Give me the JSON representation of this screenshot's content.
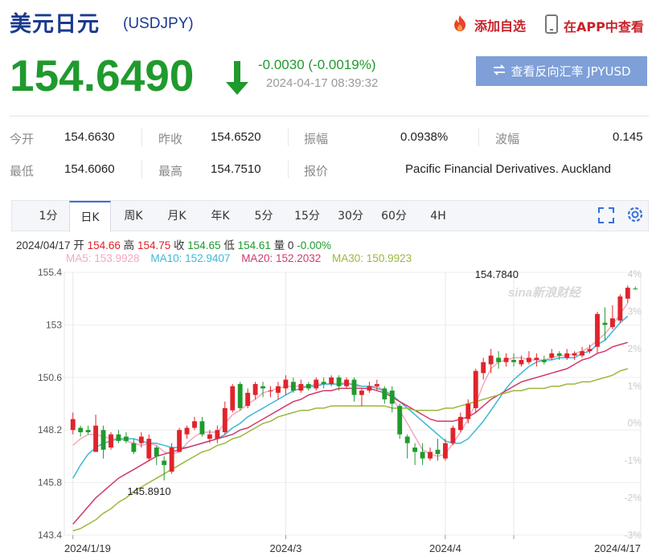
{
  "header": {
    "title": "美元日元",
    "code": "(USDJPY)",
    "fav_label": "添加自选",
    "app_label": "在APP中查看",
    "price": "154.6490",
    "change": "-0.0030 (-0.0019%)",
    "timestamp": "2024-04-17 08:39:32",
    "reverse_label": "查看反向汇率 JPYUSD"
  },
  "quote": {
    "open_label": "今开",
    "open_value": "154.6630",
    "prev_close_label": "昨收",
    "prev_close_value": "154.6520",
    "amplitude_label": "振幅",
    "amplitude_value": "0.0938%",
    "wave_label": "波幅",
    "wave_value": "0.145",
    "low_label": "最低",
    "low_value": "154.6060",
    "high_label": "最高",
    "high_value": "154.7510",
    "quote_source_label": "报价",
    "quote_source_value": "Pacific Financial Derivatives. Auckland"
  },
  "tabs": [
    "1分",
    "日K",
    "周K",
    "月K",
    "年K",
    "5分",
    "15分",
    "30分",
    "60分",
    "4H"
  ],
  "active_tab": 1,
  "info": {
    "date": "2024/04/17",
    "open_label": "开",
    "open": "154.66",
    "high_label": "高",
    "high": "154.75",
    "close_label": "收",
    "close": "154.65",
    "low_label": "低",
    "low": "154.61",
    "vol_label": "量",
    "vol": "0",
    "pct": "-0.00%",
    "ma5": "MA5: 153.9928",
    "ma10": "MA10: 152.9407",
    "ma20": "MA20: 152.2032",
    "ma30": "MA30: 150.9923"
  },
  "colors": {
    "up": "#e0242b",
    "down": "#1f9a2d",
    "ma5": "#f4a8bc",
    "ma10": "#3cb8d8",
    "ma20": "#d23a6a",
    "ma30": "#9ab83c",
    "accent": "#1a3a8f"
  },
  "chart_data": {
    "type": "candlestick",
    "ylim": [
      143.4,
      155.4
    ],
    "y_ticks": [
      "155.4",
      "153",
      "150.6",
      "148.2",
      "145.8",
      "143.4"
    ],
    "pct_ticks": [
      "4%",
      "3%",
      "2%",
      "1%",
      "0%",
      "-1%",
      "-2%",
      "-3%"
    ],
    "x_tick_labels": [
      "2024/1/19",
      "2024/3",
      "2024/4",
      "2024/4/17"
    ],
    "x_tick_index": [
      0,
      28,
      49,
      58
    ],
    "annotations": [
      {
        "text": "154.7840",
        "index": 58,
        "value": 154.784,
        "position": "above"
      },
      {
        "text": "145.8910",
        "index": 8,
        "value": 145.891,
        "position": "below"
      }
    ],
    "watermark": "sina新浪财经",
    "candles": [
      [
        148.2,
        148.7,
        148.0,
        149.0
      ],
      [
        148.3,
        148.1,
        147.9,
        148.4
      ],
      [
        148.2,
        148.1,
        148.0,
        148.4
      ],
      [
        147.2,
        148.4,
        147.2,
        148.9
      ],
      [
        148.2,
        147.3,
        146.9,
        148.4
      ],
      [
        147.4,
        148.0,
        147.3,
        148.1
      ],
      [
        148.0,
        147.7,
        147.6,
        148.2
      ],
      [
        147.9,
        147.7,
        147.6,
        148.1
      ],
      [
        147.6,
        147.2,
        147.1,
        147.8
      ],
      [
        147.6,
        147.9,
        147.4,
        148.1
      ],
      [
        146.9,
        147.8,
        146.8,
        148.0
      ],
      [
        147.4,
        147.0,
        146.6,
        147.5
      ],
      [
        146.8,
        146.6,
        145.9,
        147.0
      ],
      [
        146.3,
        147.4,
        146.2,
        147.6
      ],
      [
        147.2,
        148.2,
        147.2,
        148.3
      ],
      [
        148.0,
        148.3,
        147.8,
        148.4
      ],
      [
        148.3,
        148.6,
        148.2,
        148.8
      ],
      [
        148.6,
        148.0,
        147.9,
        148.8
      ],
      [
        147.8,
        148.0,
        147.6,
        148.2
      ],
      [
        147.8,
        148.2,
        147.6,
        148.4
      ],
      [
        148.1,
        149.2,
        148.0,
        149.5
      ],
      [
        149.1,
        150.2,
        149.0,
        150.3
      ],
      [
        150.3,
        149.2,
        149.1,
        150.4
      ],
      [
        149.3,
        149.9,
        149.2,
        150.1
      ],
      [
        149.8,
        150.3,
        149.6,
        150.4
      ],
      [
        150.2,
        150.1,
        149.7,
        150.4
      ],
      [
        150.0,
        150.0,
        149.7,
        150.2
      ],
      [
        149.9,
        150.2,
        149.6,
        150.4
      ],
      [
        150.1,
        150.5,
        149.8,
        150.7
      ],
      [
        150.4,
        150.0,
        149.9,
        150.6
      ],
      [
        150.0,
        150.3,
        149.9,
        150.5
      ],
      [
        150.3,
        150.1,
        150.0,
        150.4
      ],
      [
        150.1,
        150.5,
        150.0,
        150.6
      ],
      [
        150.4,
        150.3,
        150.1,
        150.6
      ],
      [
        150.3,
        150.6,
        150.2,
        150.7
      ],
      [
        150.6,
        150.2,
        150.0,
        150.7
      ],
      [
        150.2,
        150.5,
        150.1,
        150.6
      ],
      [
        150.5,
        149.8,
        149.5,
        150.6
      ],
      [
        149.8,
        150.0,
        149.3,
        150.1
      ],
      [
        150.0,
        150.2,
        149.9,
        150.4
      ],
      [
        150.2,
        150.3,
        150.0,
        150.5
      ],
      [
        150.1,
        149.6,
        149.4,
        150.2
      ],
      [
        150.0,
        149.4,
        149.0,
        150.2
      ],
      [
        149.3,
        148.0,
        147.8,
        149.4
      ],
      [
        147.9,
        147.6,
        146.9,
        148.0
      ],
      [
        147.4,
        147.2,
        146.6,
        147.6
      ],
      [
        147.2,
        146.9,
        146.6,
        147.6
      ],
      [
        146.9,
        147.2,
        146.8,
        147.4
      ],
      [
        147.3,
        147.1,
        146.8,
        147.8
      ],
      [
        146.9,
        147.6,
        146.8,
        147.8
      ],
      [
        147.6,
        148.3,
        147.5,
        148.4
      ],
      [
        148.2,
        148.8,
        148.1,
        149.0
      ],
      [
        148.7,
        149.4,
        148.5,
        149.6
      ],
      [
        149.2,
        150.9,
        149.0,
        151.0
      ],
      [
        150.8,
        151.3,
        150.5,
        151.5
      ],
      [
        151.2,
        151.6,
        150.8,
        151.9
      ],
      [
        151.5,
        151.3,
        151.0,
        151.8
      ],
      [
        151.3,
        151.5,
        151.1,
        151.7
      ],
      [
        151.4,
        151.3,
        151.1,
        151.7
      ],
      [
        151.2,
        151.4,
        151.1,
        151.6
      ],
      [
        151.3,
        151.5,
        151.2,
        151.8
      ],
      [
        151.4,
        151.5,
        151.1,
        151.7
      ],
      [
        151.4,
        151.3,
        151.2,
        151.6
      ],
      [
        151.5,
        151.7,
        151.4,
        151.9
      ],
      [
        151.7,
        151.6,
        151.4,
        151.8
      ],
      [
        151.5,
        151.7,
        151.4,
        151.9
      ],
      [
        151.6,
        151.7,
        151.4,
        151.8
      ],
      [
        151.6,
        151.8,
        151.5,
        152.0
      ],
      [
        151.8,
        151.9,
        151.7,
        152.1
      ],
      [
        152.0,
        153.5,
        151.7,
        153.6
      ],
      [
        153.1,
        153.0,
        152.3,
        153.8
      ],
      [
        152.9,
        153.3,
        152.8,
        153.9
      ],
      [
        153.2,
        154.3,
        153.1,
        154.4
      ],
      [
        154.2,
        154.7,
        154.0,
        154.8
      ],
      [
        154.66,
        154.65,
        154.61,
        154.75
      ]
    ],
    "ma_series": [
      {
        "name": "MA5",
        "values": [
          147.5,
          147.8,
          148.0,
          148.0,
          147.9,
          147.8,
          147.8,
          147.7,
          147.6,
          147.5,
          147.6,
          147.5,
          147.2,
          147.1,
          147.2,
          147.6,
          147.9,
          148.1,
          148.1,
          148.1,
          148.5,
          148.9,
          149.1,
          149.4,
          149.6,
          149.9,
          150.0,
          150.1,
          150.2,
          150.2,
          150.2,
          150.2,
          150.3,
          150.3,
          150.3,
          150.3,
          150.4,
          150.2,
          150.2,
          150.2,
          150.2,
          150.0,
          149.7,
          149.1,
          148.5,
          147.9,
          147.3,
          147.1,
          147.0,
          147.1,
          147.6,
          148.1,
          148.7,
          149.4,
          150.3,
          151.0,
          151.3,
          151.4,
          151.5,
          151.5,
          151.4,
          151.4,
          151.4,
          151.5,
          151.6,
          151.6,
          151.7,
          151.8,
          152.0,
          152.3,
          152.6,
          153.0,
          153.5,
          154.0
        ]
      },
      {
        "name": "MA10",
        "values": [
          146.0,
          146.6,
          147.1,
          147.4,
          147.6,
          147.7,
          147.8,
          147.8,
          147.8,
          147.7,
          147.6,
          147.6,
          147.5,
          147.4,
          147.4,
          147.4,
          147.5,
          147.6,
          147.7,
          147.8,
          148.0,
          148.3,
          148.5,
          148.8,
          149.0,
          149.2,
          149.4,
          149.6,
          149.8,
          150.0,
          150.1,
          150.2,
          150.2,
          150.3,
          150.3,
          150.3,
          150.3,
          150.3,
          150.2,
          150.2,
          150.1,
          150.0,
          149.8,
          149.5,
          149.2,
          148.9,
          148.6,
          148.3,
          148.0,
          147.7,
          147.6,
          147.6,
          147.8,
          148.2,
          148.6,
          149.1,
          149.6,
          150.1,
          150.5,
          150.8,
          151.1,
          151.3,
          151.4,
          151.4,
          151.5,
          151.5,
          151.5,
          151.7,
          151.8,
          152.1,
          152.3,
          152.7,
          153.1,
          153.4
        ]
      },
      {
        "name": "MA20",
        "values": [
          143.9,
          144.3,
          144.7,
          145.1,
          145.4,
          145.7,
          146.0,
          146.2,
          146.4,
          146.6,
          146.8,
          147.0,
          147.1,
          147.2,
          147.3,
          147.4,
          147.5,
          147.6,
          147.7,
          147.8,
          147.9,
          148.0,
          148.2,
          148.3,
          148.5,
          148.7,
          148.9,
          149.1,
          149.3,
          149.5,
          149.6,
          149.8,
          149.9,
          150.0,
          150.0,
          150.1,
          150.1,
          150.1,
          150.1,
          150.1,
          150.0,
          149.9,
          149.7,
          149.5,
          149.3,
          149.1,
          148.9,
          148.7,
          148.6,
          148.6,
          148.6,
          148.7,
          148.8,
          149.0,
          149.3,
          149.6,
          149.8,
          150.0,
          150.2,
          150.4,
          150.5,
          150.6,
          150.7,
          150.8,
          150.9,
          151.0,
          151.2,
          151.4,
          151.5,
          151.7,
          151.8,
          152.0,
          152.1,
          152.2
        ]
      },
      {
        "name": "MA30",
        "values": [
          143.6,
          143.7,
          143.9,
          144.1,
          144.4,
          144.6,
          144.9,
          145.1,
          145.4,
          145.6,
          145.8,
          146.0,
          146.2,
          146.4,
          146.6,
          146.8,
          147.0,
          147.2,
          147.3,
          147.5,
          147.6,
          147.8,
          147.9,
          148.1,
          148.3,
          148.5,
          148.6,
          148.8,
          148.9,
          149.0,
          149.1,
          149.1,
          149.2,
          149.2,
          149.3,
          149.3,
          149.3,
          149.3,
          149.3,
          149.3,
          149.3,
          149.3,
          149.2,
          149.2,
          149.2,
          149.1,
          149.1,
          149.1,
          149.1,
          149.2,
          149.2,
          149.3,
          149.4,
          149.5,
          149.6,
          149.7,
          149.8,
          149.9,
          150.0,
          150.0,
          150.1,
          150.1,
          150.1,
          150.2,
          150.2,
          150.3,
          150.3,
          150.4,
          150.4,
          150.5,
          150.6,
          150.7,
          150.9,
          151.0
        ]
      }
    ]
  }
}
